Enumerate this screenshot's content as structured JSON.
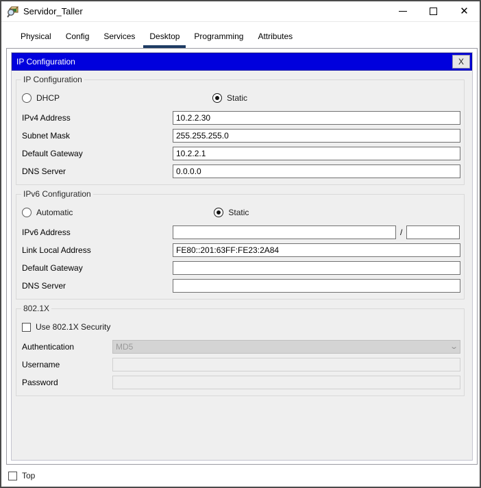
{
  "window": {
    "title": "Servidor_Taller"
  },
  "icons": {
    "app": "packet-tracer-device-icon",
    "minimize": "minimize-icon",
    "maximize": "maximize-icon",
    "close": "✕",
    "dropdown_chevron": "⌄"
  },
  "tabs": [
    {
      "label": "Physical",
      "selected": false
    },
    {
      "label": "Config",
      "selected": false
    },
    {
      "label": "Services",
      "selected": false
    },
    {
      "label": "Desktop",
      "selected": true
    },
    {
      "label": "Programming",
      "selected": false
    },
    {
      "label": "Attributes",
      "selected": false
    }
  ],
  "dialog": {
    "title": "IP Configuration",
    "close_label": "X"
  },
  "ip_configuration": {
    "legend": "IP Configuration",
    "dhcp_label": "DHCP",
    "static_label": "Static",
    "selected_mode": "Static",
    "fields": [
      {
        "label": "IPv4 Address",
        "value": "10.2.2.30"
      },
      {
        "label": "Subnet Mask",
        "value": "255.255.255.0"
      },
      {
        "label": "Default Gateway",
        "value": "10.2.2.1"
      },
      {
        "label": "DNS Server",
        "value": "0.0.0.0"
      }
    ]
  },
  "ipv6_configuration": {
    "legend": "IPv6 Configuration",
    "automatic_label": "Automatic",
    "static_label": "Static",
    "selected_mode": "Static",
    "ipv6_address_label": "IPv6 Address",
    "ipv6_address_value": "",
    "prefix_separator": "/",
    "prefix_value": "",
    "fields": [
      {
        "label": "Link Local Address",
        "value": "FE80::201:63FF:FE23:2A84"
      },
      {
        "label": "Default Gateway",
        "value": ""
      },
      {
        "label": "DNS Server",
        "value": ""
      }
    ]
  },
  "dot1x": {
    "legend": "802.1X",
    "checkbox_label": "Use 802.1X Security",
    "checked": false,
    "authentication_label": "Authentication",
    "authentication_value": "MD5",
    "username_label": "Username",
    "username_value": "",
    "password_label": "Password",
    "password_value": ""
  },
  "footer": {
    "top_label": "Top",
    "checked": false
  },
  "colors": {
    "dialog_titlebar": "#0000dd",
    "tab_underline": "#1e3c64",
    "disabled_field_bg": "#efefef",
    "dropdown_bg": "#d4d4d4"
  }
}
